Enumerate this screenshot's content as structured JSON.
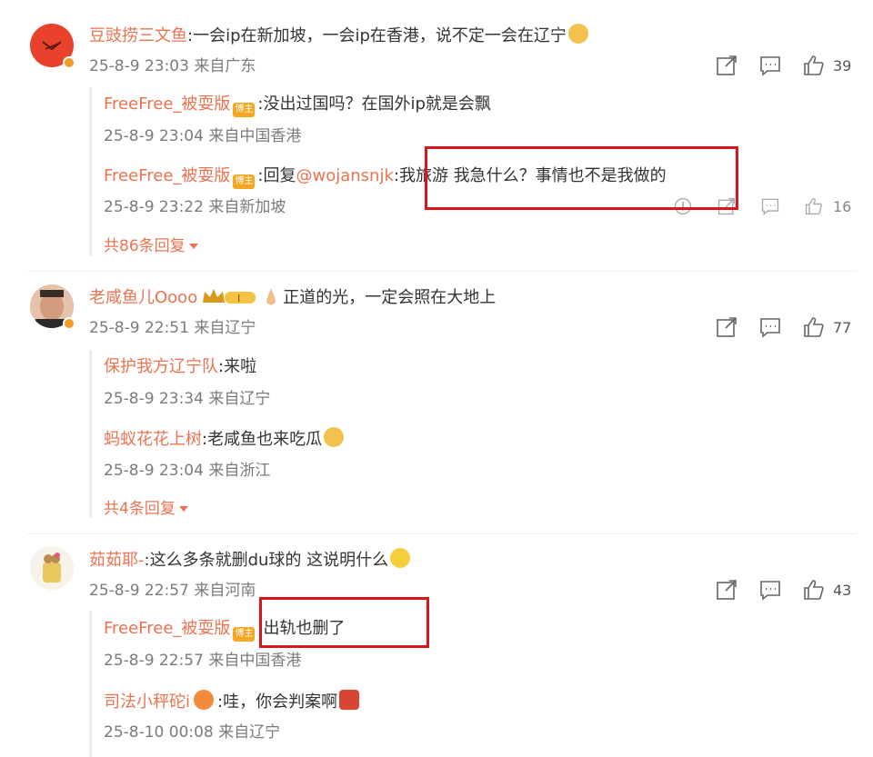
{
  "comments": [
    {
      "user": "豆豉捞三文鱼",
      "text": ":一会ip在新加坡，一会ip在香港，说不定一会在辽宁",
      "time": "25-8-9 23:03",
      "location": "来自广东",
      "likes": "39",
      "replies": [
        {
          "user": "FreeFree_被耍版",
          "badge": "博主",
          "text": ":没出过国吗？在国外ip就是会飘",
          "time": "25-8-9 23:04",
          "location": "来自中国香港"
        },
        {
          "user": "FreeFree_被耍版",
          "badge": "博主",
          "prefix": ":回复",
          "mention": "@wojansnjk",
          "text": ":我旅游 我急什么？事情也不是我做的",
          "time": "25-8-9 23:22",
          "location": "来自新加坡",
          "likes": "16"
        }
      ],
      "more": "共86条回复"
    },
    {
      "user": "老咸鱼儿Oooo",
      "text": "正道的光，一定会照在大地上",
      "time": "25-8-9 22:51",
      "location": "来自辽宁",
      "likes": "77",
      "crown_level": "I",
      "replies": [
        {
          "user": "保护我方辽宁队",
          "text": ":来啦",
          "time": "25-8-9 23:34",
          "location": "来自辽宁"
        },
        {
          "user": "蚂蚁花花上树",
          "text": ":老咸鱼也来吃瓜",
          "time": "25-8-9 23:04",
          "location": "来自浙江"
        }
      ],
      "more": "共4条回复"
    },
    {
      "user": "茹茹耶-",
      "text": ":这么多条就删du球的 这说明什么",
      "time": "25-8-9 22:57",
      "location": "来自河南",
      "likes": "43",
      "replies": [
        {
          "user": "FreeFree_被耍版",
          "badge": "博主",
          "text": ":出轨也删了",
          "time": "25-8-9 22:57",
          "location": "来自中国香港"
        },
        {
          "user": "司法小秤砣i",
          "text": ":哇，你会判案啊",
          "time": "25-8-10 00:08",
          "location": "来自辽宁"
        }
      ]
    }
  ],
  "icons": [
    "share-icon",
    "comment-icon",
    "like-icon",
    "report-icon",
    "chevron-down-icon"
  ],
  "colors": {
    "username": "#eb7350",
    "meta": "#7b7b7b",
    "highlight_box": "#d9161c",
    "badge": "#f5a623"
  }
}
